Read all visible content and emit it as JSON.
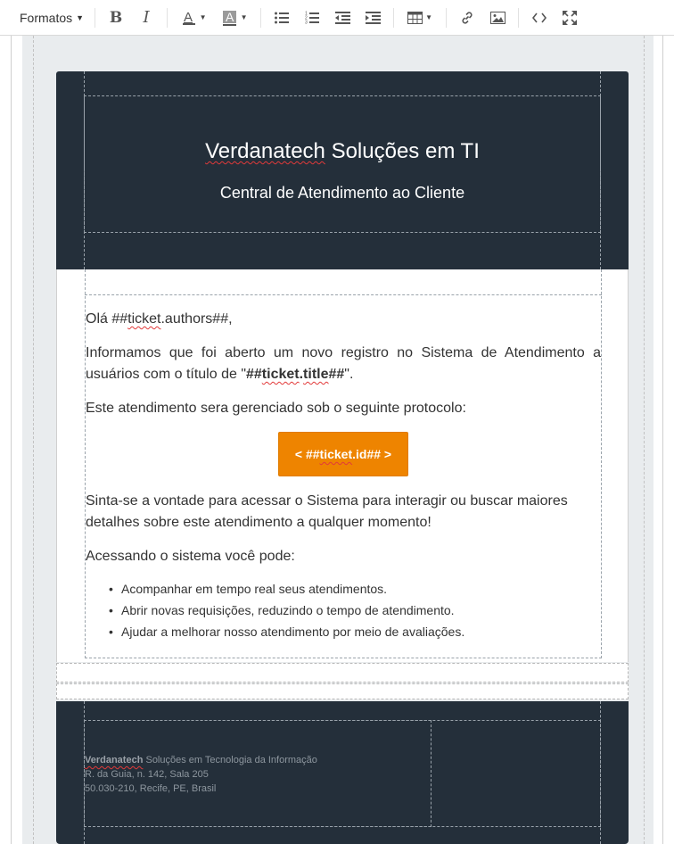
{
  "toolbar": {
    "formats_label": "Formatos",
    "buttons": [
      {
        "name": "bold",
        "icon": "bold-icon"
      },
      {
        "name": "italic",
        "icon": "italic-icon"
      },
      {
        "name": "text-color",
        "icon": "text-color-icon"
      },
      {
        "name": "background-color",
        "icon": "background-color-icon"
      },
      {
        "name": "bullet-list",
        "icon": "bullet-list-icon"
      },
      {
        "name": "numbered-list",
        "icon": "numbered-list-icon"
      },
      {
        "name": "outdent",
        "icon": "outdent-icon"
      },
      {
        "name": "indent",
        "icon": "indent-icon"
      },
      {
        "name": "table",
        "icon": "table-icon"
      },
      {
        "name": "link",
        "icon": "link-icon"
      },
      {
        "name": "image",
        "icon": "image-icon"
      },
      {
        "name": "source-code",
        "icon": "code-icon"
      },
      {
        "name": "fullscreen",
        "icon": "fullscreen-icon"
      }
    ],
    "text_color_glyph": "A",
    "bg_color_glyph": "A"
  },
  "email": {
    "header": {
      "title_brand": "Verdanatech",
      "title_rest": " Soluções em TI",
      "subtitle": "Central de Atendimento ao Cliente"
    },
    "body": {
      "greeting_prefix": "Olá ##",
      "greeting_var": "ticket",
      "greeting_suffix": ".authors##,",
      "p1_text": "Informamos que foi aberto um novo registro no Sistema de Atendimento a usuários com o título de \"",
      "p1_var_bold_a": "##",
      "p1_var_bold_b": "ticket",
      "p1_var_bold_c": ".",
      "p1_var_bold_d": "title",
      "p1_var_bold_e": "##",
      "p1_end": "\".",
      "p2": "Este atendimento sera gerenciado sob o seguinte protocolo:",
      "cta_prefix": "< ##",
      "cta_var": "ticket",
      "cta_suffix": ".id## >",
      "p3": "Sinta-se a vontade para acessar o Sistema para interagir ou buscar maiores detalhes sobre este atendimento a qualquer momento!",
      "p4": "Acessando o sistema você pode:",
      "list": [
        "Acompanhar em tempo real seus atendimentos.",
        "Abrir novas requisições, reduzindo o tempo de atendimento.",
        "Ajudar a melhorar nosso atendimento por meio de avaliações."
      ]
    },
    "footer": {
      "company_brand": "Verdanatech",
      "company_rest": " Soluções em Tecnologia da Informação",
      "address_line": "R. da Guia, n. 142, Sala 205",
      "city_line": "50.030-210, Recife, PE, Brasil"
    },
    "colors": {
      "header_bg": "#242f3a",
      "cta_bg": "#ee8400",
      "canvas_bg": "#e9ecee"
    }
  }
}
